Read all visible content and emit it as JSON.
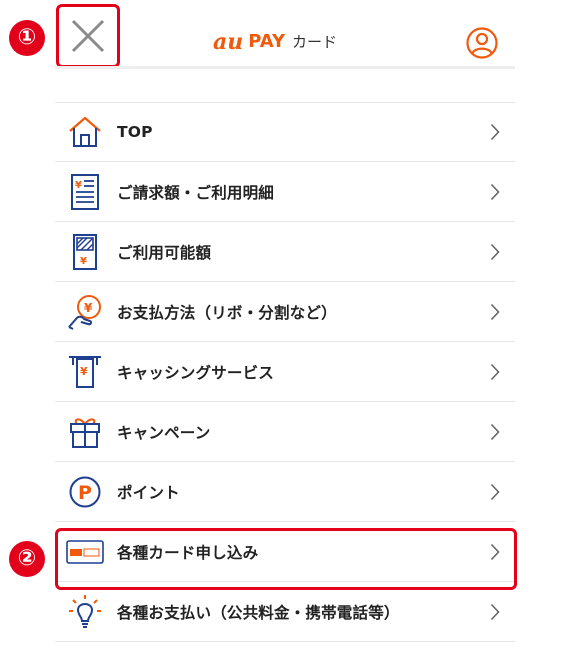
{
  "header": {
    "logo_au": "au",
    "logo_pay": "PAY",
    "logo_card": "カード",
    "accent_color": "#ef5a0d"
  },
  "callouts": {
    "marker_1": "①",
    "marker_2": "②",
    "color": "#e2001a"
  },
  "icons": {
    "close": "close-icon",
    "account": "account-icon",
    "chevron": "chevron-right-icon"
  },
  "menu": {
    "items": [
      {
        "label": "TOP",
        "icon": "home-icon"
      },
      {
        "label": "ご請求額・ご利用明細",
        "icon": "statement-icon"
      },
      {
        "label": "ご利用可能額",
        "icon": "available-amount-icon"
      },
      {
        "label": "お支払方法（リボ・分割など）",
        "icon": "payment-method-icon"
      },
      {
        "label": "キャッシングサービス",
        "icon": "cashing-icon"
      },
      {
        "label": "キャンペーン",
        "icon": "gift-icon"
      },
      {
        "label": "ポイント",
        "icon": "point-icon"
      },
      {
        "label": "各種カード申し込み",
        "icon": "card-icon"
      },
      {
        "label": "各種お支払い（公共料金・携帯電話等）",
        "icon": "lightbulb-icon"
      }
    ]
  }
}
